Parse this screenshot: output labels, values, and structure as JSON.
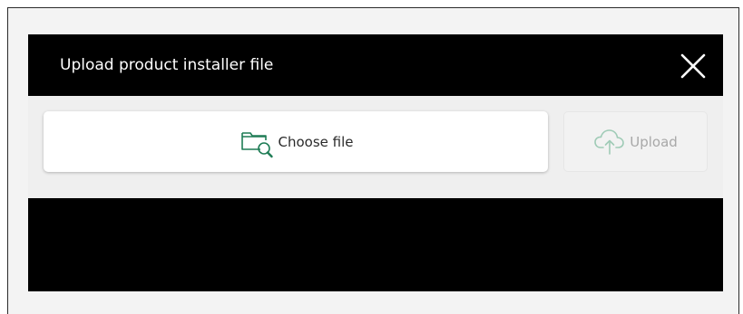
{
  "dialog": {
    "title": "Upload product installer file",
    "close_icon": "close-icon"
  },
  "actions": {
    "choose_file": {
      "label": "Choose file",
      "icon": "folder-search-icon",
      "icon_color": "#1e7c55"
    },
    "upload": {
      "label": "Upload",
      "icon": "cloud-upload-icon",
      "icon_color": "#9fcbb6",
      "state": "disabled"
    }
  }
}
